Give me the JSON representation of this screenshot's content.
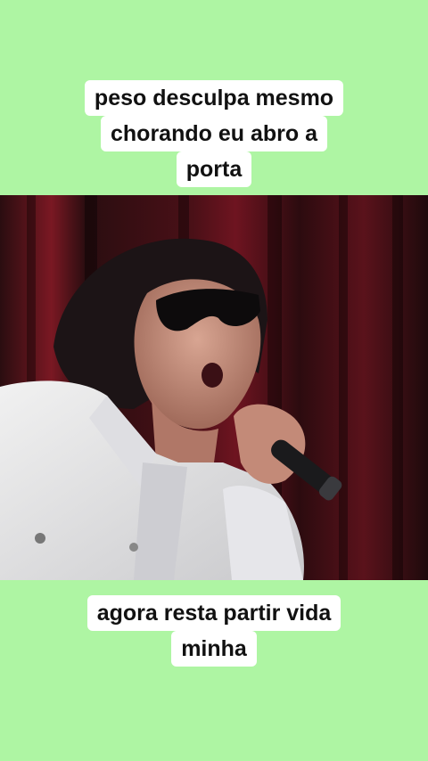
{
  "top_caption": {
    "lines": [
      "peso desculpa mesmo",
      "chorando eu abro a",
      "porta"
    ]
  },
  "bottom_caption": {
    "lines": [
      "agora resta partir vida",
      "minha"
    ]
  },
  "colors": {
    "background": "#aef5a3",
    "caption_bg": "#ffffff",
    "caption_text": "#111111",
    "curtain_dark": "#1a0b0d",
    "curtain_red": "#6e1420"
  },
  "video": {
    "subject": "singer with dark sunglasses in white jacket singing into microphone in front of red curtain"
  }
}
